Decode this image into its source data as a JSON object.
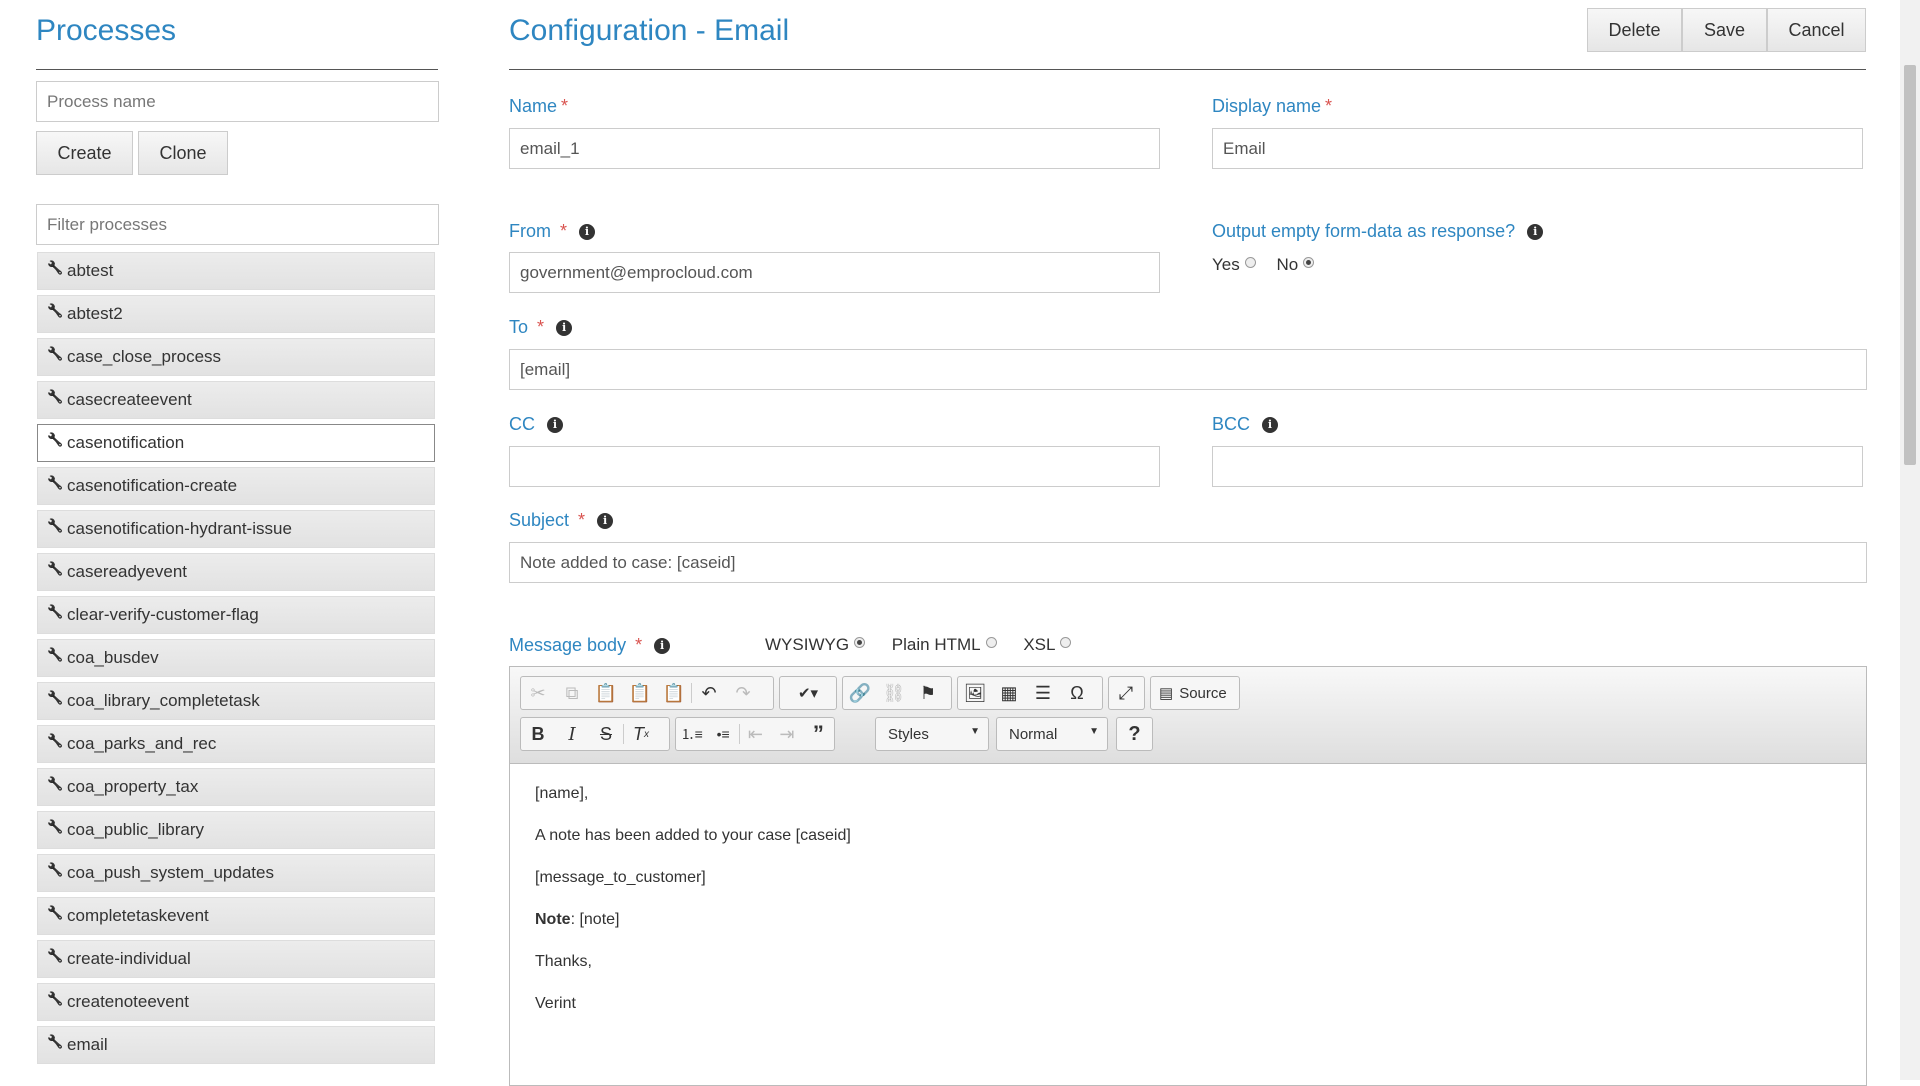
{
  "sidebar": {
    "title": "Processes",
    "process_name_placeholder": "Process name",
    "create_label": "Create",
    "clone_label": "Clone",
    "filter_placeholder": "Filter processes",
    "items": [
      "abtest",
      "abtest2",
      "case_close_process",
      "casecreateevent",
      "casenotification",
      "casenotification-create",
      "casenotification-hydrant-issue",
      "casereadyevent",
      "clear-verify-customer-flag",
      "coa_busdev",
      "coa_library_completetask",
      "coa_parks_and_rec",
      "coa_property_tax",
      "coa_public_library",
      "coa_push_system_updates",
      "completetaskevent",
      "create-individual",
      "createnoteevent",
      "email"
    ],
    "selected_item": "casenotification"
  },
  "header": {
    "title": "Configuration - Email",
    "delete_label": "Delete",
    "save_label": "Save",
    "cancel_label": "Cancel"
  },
  "form": {
    "name_label": "Name",
    "name_value": "email_1",
    "display_name_label": "Display name",
    "display_name_value": "Email",
    "from_label": "From",
    "from_value": "government@emprocloud.com",
    "output_empty_label": "Output empty form-data as response?",
    "yes_label": "Yes",
    "no_label": "No",
    "output_empty_selected": "No",
    "to_label": "To",
    "to_value": "[email]",
    "cc_label": "CC",
    "cc_value": "",
    "bcc_label": "BCC",
    "bcc_value": "",
    "subject_label": "Subject",
    "subject_value": "Note added to case: [caseid]",
    "message_body_label": "Message body",
    "body_modes": [
      "WYSIWYG",
      "Plain HTML",
      "XSL"
    ],
    "body_mode_selected": "WYSIWYG",
    "required_marker": "*",
    "info_glyph": "i"
  },
  "editor": {
    "source_label": "Source",
    "styles_label": "Styles",
    "format_label": "Normal",
    "help_label": "?",
    "body": {
      "line1": "[name],",
      "line2": "A note has been added to your case [caseid]",
      "line3": "[message_to_customer]",
      "note_bold": "Note",
      "note_rest": ": [note]",
      "line5": "Thanks,",
      "line6": "Verint"
    }
  },
  "colors": {
    "accent": "#2e86c1",
    "required": "#d9534f"
  }
}
